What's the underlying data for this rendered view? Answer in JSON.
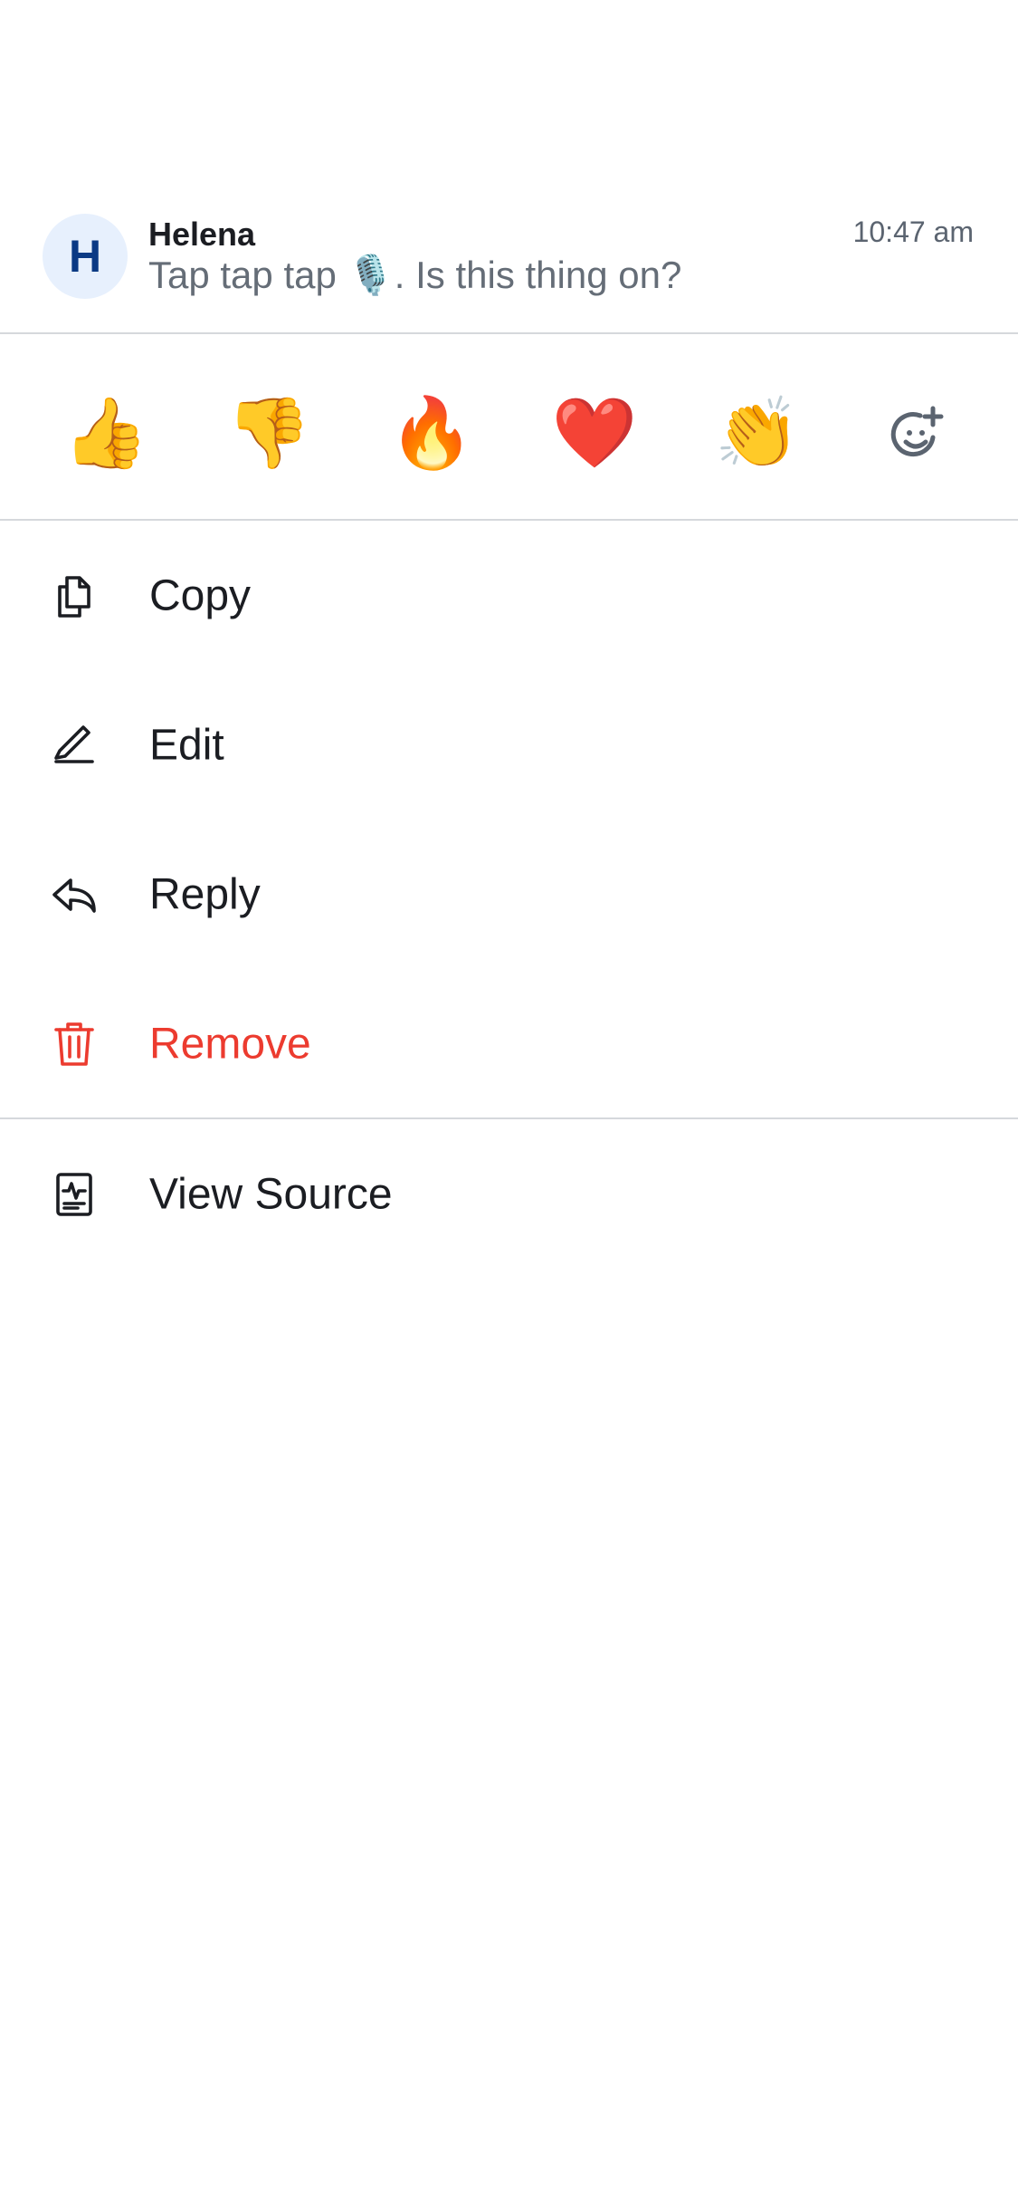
{
  "message": {
    "avatar_initial": "H",
    "sender": "Helena",
    "timestamp": "10:47 am",
    "text": "Tap tap tap 🎙️. Is this thing on?"
  },
  "reactions": [
    {
      "emoji": "👍",
      "name": "thumbs-up"
    },
    {
      "emoji": "👎",
      "name": "thumbs-down"
    },
    {
      "emoji": "🔥",
      "name": "fire"
    },
    {
      "emoji": "❤️",
      "name": "heart"
    },
    {
      "emoji": "👏",
      "name": "clap"
    }
  ],
  "add_reaction_icon": "emoji-add-icon",
  "menu": {
    "copy": {
      "label": "Copy",
      "icon": "copy-icon"
    },
    "edit": {
      "label": "Edit",
      "icon": "pencil-icon"
    },
    "reply": {
      "label": "Reply",
      "icon": "reply-icon"
    },
    "remove": {
      "label": "Remove",
      "icon": "trash-icon"
    },
    "view_source": {
      "label": "View Source",
      "icon": "source-icon"
    }
  },
  "colors": {
    "avatar_bg": "#e7f0fd",
    "avatar_fg": "#0b3a84",
    "danger": "#ec3b2f",
    "divider": "#d5d8dc"
  }
}
